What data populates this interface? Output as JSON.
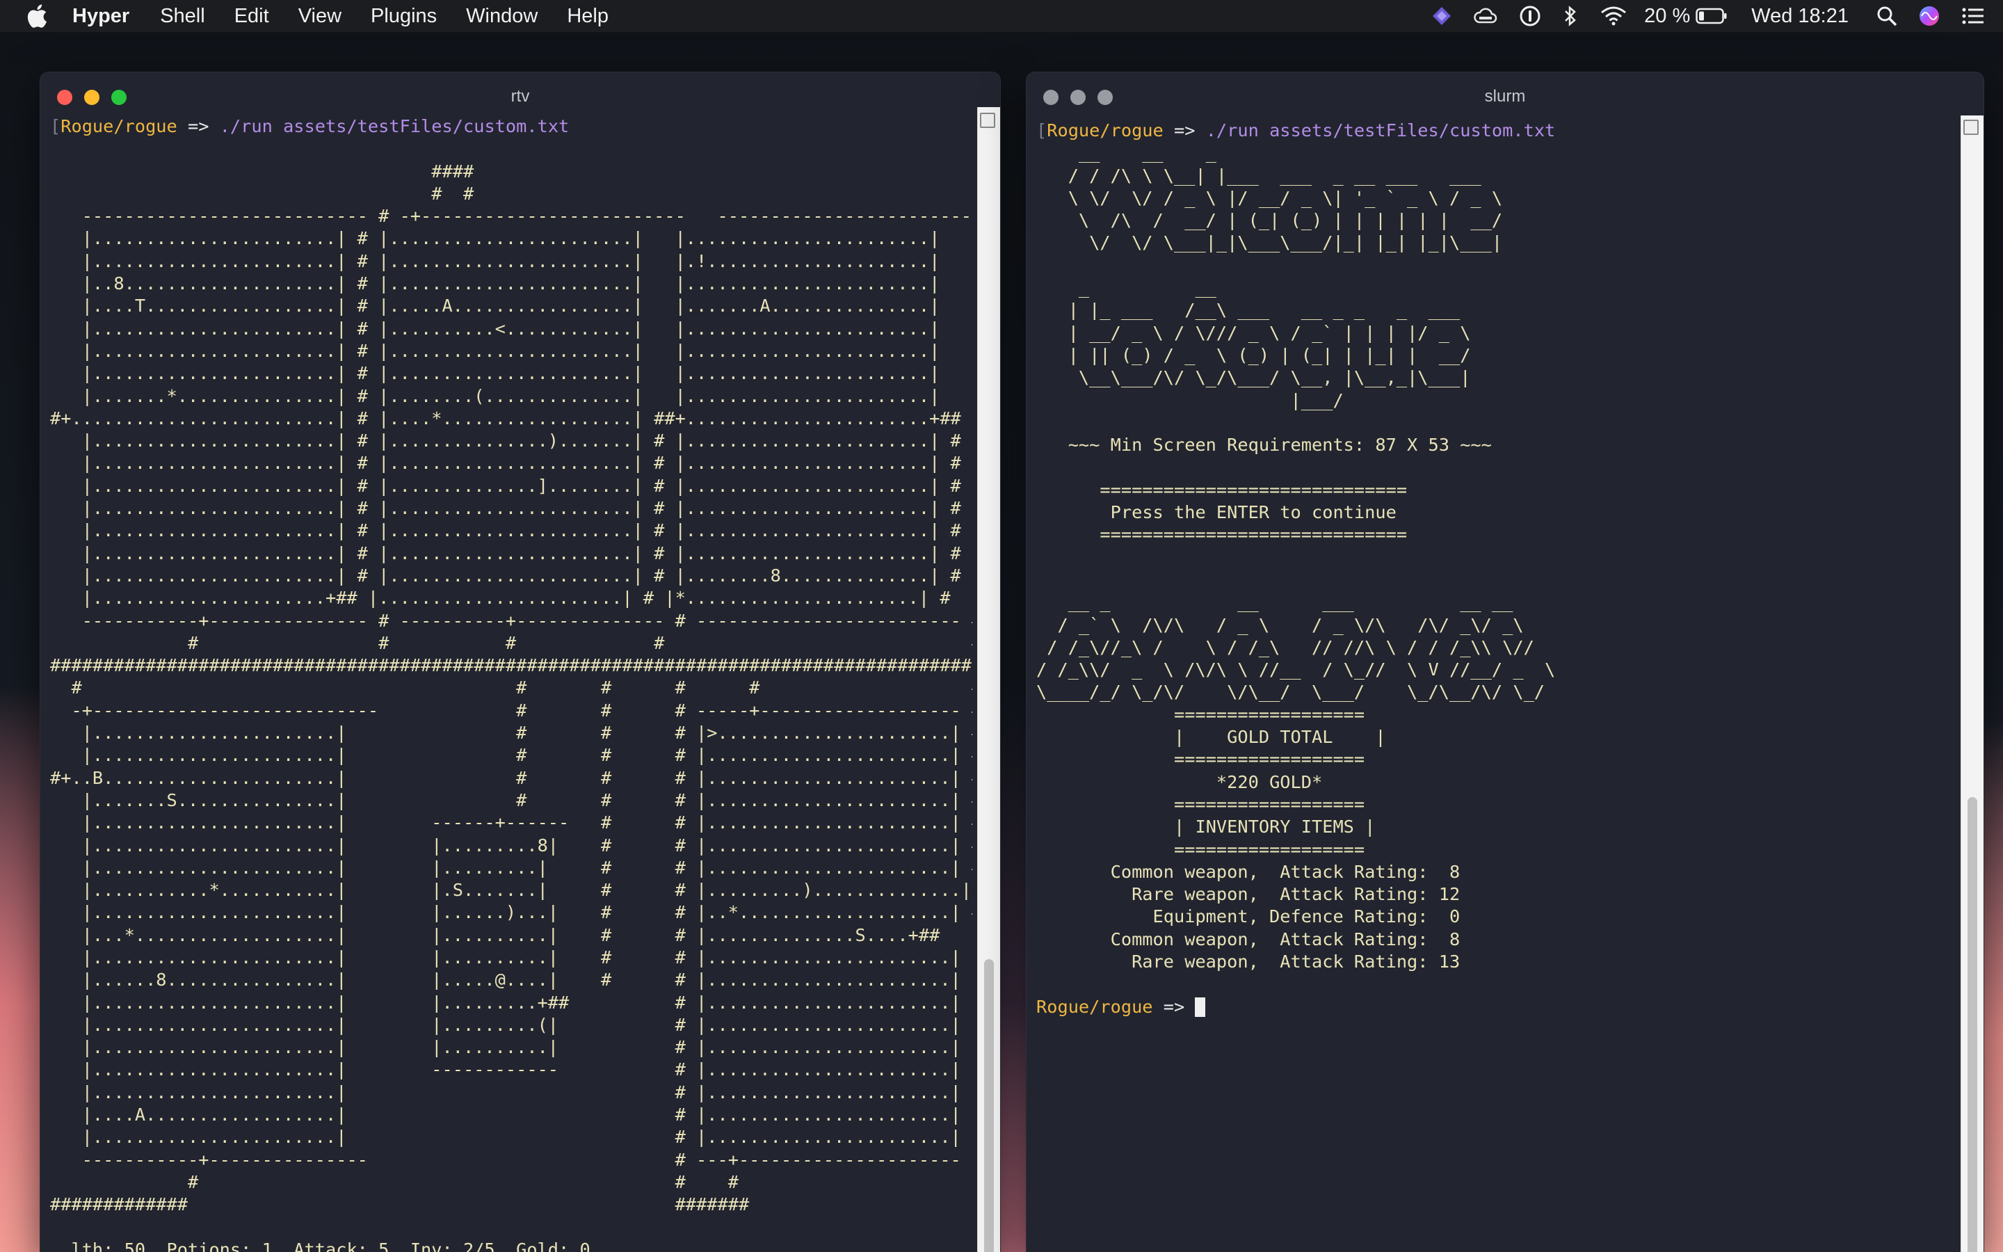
{
  "menubar": {
    "app": "Hyper",
    "items": [
      "Shell",
      "Edit",
      "View",
      "Plugins",
      "Window",
      "Help"
    ],
    "battery": "20 %",
    "clock": "Wed 18:21",
    "status_icons": [
      "app-icon",
      "cloud-icon",
      "onepassword-icon",
      "bluetooth-icon",
      "wifi-icon",
      "battery-icon",
      "search-icon",
      "siri-icon",
      "list-icon"
    ]
  },
  "left_window": {
    "title": "rtv",
    "prompt_path": "Rogue/rogue",
    "prompt_arrow": " => ",
    "command": "./run assets/testFiles/custom.txt",
    "map": "                                    ####\n                                    #  #\n   --------------------------- # -+-------------------------   -------------------------\n   |.......................| # |.......................|   |.......................|\n   |.......................| # |.......................|   |.!.....................|\n   |..8....................| # |.......................|   |.......................|\n   |....T..................| # |.....A.................|   |.......A...............|\n   |.......................| # |..........<............|   |.......................|\n   |.......................| # |.......................|   |.......................|\n   |.......................| # |.......................|   |.......................|\n   |.......*...............| # |........(..............|   |.......................|\n#+.........................| # |....*..................| ##+.......................+##\n   |.......................| # |...............).......| # |.......................| #\n   |.......................| # |.......................| # |.......................| #\n   |.......................| # |..............]........| # |.......................| #\n   |.......................| # |.......................| # |.......................| #\n   |.......................| # |.......................| # |.......................| #\n   |.......................| # |.......................| # |.......................| #\n   |.......................| # |.......................| # |........8..............| #\n   |......................+## |.......................| # |*......................| #\n   -----------+--------------- # ----------+-------------- # ------------------------- #\n             #                 #           #             #                             #\n#######################################################################################\n  #                                         #       #      #      #                    #\n  -+---------------------------             #       #      # -----+------------------- #\n   |.......................|                #       #      # |>......................| #\n   |.......................|                #       #      # |.......................| #\n#+..B......................|                #       #      # |.......................| #\n   |.......S...............|                #       #      # |.......................| #\n   |.......................|        ------+------   #      # |.......................| #\n   |.......................|        |.........8|    #      # |.......................| #\n   |.......................|        |.........|     #      # |.......................| #\n   |...........*...........|        |.S.......|     #      # |.........)..............| #\n   |.......................|        |......)...|    #      # |..*....................| #\n   |...*...................|        |..........|    #      # |..............S....+##\n   |.......................|        |..........|    #      # |.......................|\n   |......8................|        |.....@....|    #      # |.......................|\n   |.......................|        |.........+##          # |.......................|\n   |.......................|        |.........(|           # |.......................|\n   |.......................|        |..........|           # |.......................|\n   |.......................|        ------------           # |.......................|\n   |.......................|                               # |.......................|\n   |....A..................|                               # |.......................|\n   |.......................|                               # |.......................|\n   -----------+---------------                             # ---+---------------------\n             #                                             #    #\n#############                                              #######",
    "status_line": "  lth: 50  Potions: 1  Attack: 5  Inv: 2/5  Gold: 0"
  },
  "right_window": {
    "title": "slurm",
    "prompt_path": "Rogue/rogue",
    "prompt_arrow": " => ",
    "command": "./run assets/testFiles/custom.txt",
    "banner": "    __    __    _\n   / / /\\ \\ \\__| |___  ___  _ __ ___   ___\n   \\ \\/  \\/ / _ \\ |/ __/ _ \\| '_ ` _ \\ / _ \\\n    \\  /\\  /  __/ | (_| (_) | | | | | |  __/\n     \\/  \\/ \\___|_|\\___\\___/|_| |_| |_|\\___|\n\n    _          __\n   | |_ ___   /__\\ ___   __ _ _   _  ___\n   | __/ _ \\ / \\/// _ \\ / _` | | | |/ _ \\\n   | || (_) / _  \\ (_) | (_| | |_| |  __/\n    \\__\\___/\\/ \\_/\\___/ \\__, |\\__,_|\\___|\n                        |___/",
    "min_req": "   ~~~ Min Screen Requirements: 87 X 53 ~~~",
    "rule": "=============================",
    "press_enter": "Press the ENTER to continue",
    "over_banner": "   __ _            __      ___          __ __\n  / _` \\  /\\/\\   / _ \\    / _ \\/\\   /\\/ _\\/ _\\\n / /_\\//_\\ /    \\ / /_\\   // //\\ \\ / / /_\\\\ \\//\n/ /_\\\\/  _  \\ /\\/\\ \\ //__  / \\_//  \\ V //__/ _  \\\n\\____/_/ \\_/\\/    \\/\\__/  \\___/    \\_/\\__/\\/ \\_/",
    "gold_rule": "==================",
    "gold_title": "|    GOLD TOTAL    |",
    "gold_value": "*220 GOLD*",
    "inv_title": "| INVENTORY ITEMS |",
    "inventory": [
      "   Common weapon,  Attack Rating:  8",
      "     Rare weapon,  Attack Rating: 12",
      "       Equipment, Defence Rating:  0",
      "   Common weapon,  Attack Rating:  8",
      "     Rare weapon,  Attack Rating: 13"
    ]
  },
  "colors": {
    "terminal_bg": "#22252f",
    "terminal_text": "#e8e2b8",
    "prompt_path": "#f0b643",
    "command": "#b48ce8"
  }
}
